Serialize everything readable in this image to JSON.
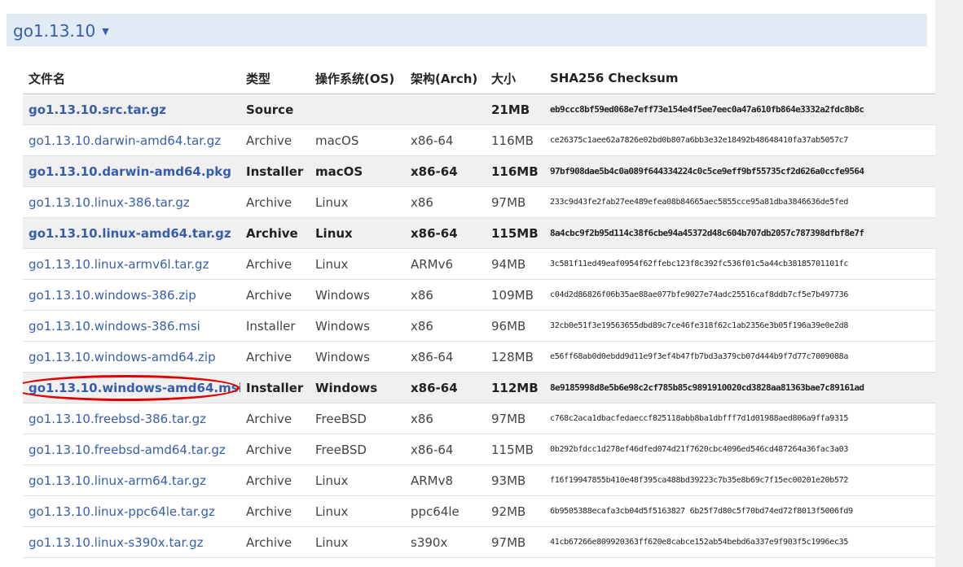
{
  "version": {
    "title": "go1.13.10",
    "arrow": "▼"
  },
  "table": {
    "headers": {
      "filename": "文件名",
      "kind": "类型",
      "os": "操作系统(OS)",
      "arch": "架构(Arch)",
      "size": "大小",
      "checksum": "SHA256 Checksum"
    },
    "rows": [
      {
        "filename": "go1.13.10.src.tar.gz",
        "kind": "Source",
        "os": "",
        "arch": "",
        "size": "21MB",
        "checksum": "eb9ccc8bf59ed068e7eff73e154e4f5ee7eec0a47a610fb864e3332a2fdc8b8c",
        "highlight": true
      },
      {
        "filename": "go1.13.10.darwin-amd64.tar.gz",
        "kind": "Archive",
        "os": "macOS",
        "arch": "x86-64",
        "size": "116MB",
        "checksum": "ce26375c1aee62a7826e02bd0b807a6bb3e32e18492b48648410fa37ab5057c7",
        "highlight": false
      },
      {
        "filename": "go1.13.10.darwin-amd64.pkg",
        "kind": "Installer",
        "os": "macOS",
        "arch": "x86-64",
        "size": "116MB",
        "checksum": "97bf908dae5b4c0a089f644334224c0c5ce9eff9bf55735cf2d626a0ccfe9564",
        "highlight": true
      },
      {
        "filename": "go1.13.10.linux-386.tar.gz",
        "kind": "Archive",
        "os": "Linux",
        "arch": "x86",
        "size": "97MB",
        "checksum": "233c9d43fe2fab27ee489efea08b84665aec5855cce95a81dba3846636de5fed",
        "highlight": false
      },
      {
        "filename": "go1.13.10.linux-amd64.tar.gz",
        "kind": "Archive",
        "os": "Linux",
        "arch": "x86-64",
        "size": "115MB",
        "checksum": "8a4cbc9f2b95d114c38f6cbe94a45372d48c604b707db2057c787398dfbf8e7f",
        "highlight": true
      },
      {
        "filename": "go1.13.10.linux-armv6l.tar.gz",
        "kind": "Archive",
        "os": "Linux",
        "arch": "ARMv6",
        "size": "94MB",
        "checksum": "3c581f11ed49eaf0954f62ffebc123f8c392fc536f01c5a44cb38185701101fc",
        "highlight": false
      },
      {
        "filename": "go1.13.10.windows-386.zip",
        "kind": "Archive",
        "os": "Windows",
        "arch": "x86",
        "size": "109MB",
        "checksum": "c04d2d86826f06b35ae88ae077bfe9027e74adc25516caf8ddb7cf5e7b497736",
        "highlight": false
      },
      {
        "filename": "go1.13.10.windows-386.msi",
        "kind": "Installer",
        "os": "Windows",
        "arch": "x86",
        "size": "96MB",
        "checksum": "32cb0e51f3e19563655dbd89c7ce46fe318f62c1ab2356e3b05f196a39e0e2d8",
        "highlight": false
      },
      {
        "filename": "go1.13.10.windows-amd64.zip",
        "kind": "Archive",
        "os": "Windows",
        "arch": "x86-64",
        "size": "128MB",
        "checksum": "e56ff68ab0d0ebdd9d11e9f3ef4b47fb7bd3a379cb07d444b9f7d77c7009088a",
        "highlight": false
      },
      {
        "filename": "go1.13.10.windows-amd64.msi",
        "kind": "Installer",
        "os": "Windows",
        "arch": "x86-64",
        "size": "112MB",
        "checksum": "8e9185998d8e5b6e98c2cf785b85c9891910020cd3828aa81363bae7c89161ad",
        "highlight": true,
        "circled": true
      },
      {
        "filename": "go1.13.10.freebsd-386.tar.gz",
        "kind": "Archive",
        "os": "FreeBSD",
        "arch": "x86",
        "size": "97MB",
        "checksum": "c768c2aca1dbacfedaeccf825118abb8ba1dbfff7d1d01988aed806a9ffa9315",
        "highlight": false
      },
      {
        "filename": "go1.13.10.freebsd-amd64.tar.gz",
        "kind": "Archive",
        "os": "FreeBSD",
        "arch": "x86-64",
        "size": "115MB",
        "checksum": "0b292bfdcc1d278ef46dfed074d21f7620cbc4096ed546cd487264a36fac3a03",
        "highlight": false
      },
      {
        "filename": "go1.13.10.linux-arm64.tar.gz",
        "kind": "Archive",
        "os": "Linux",
        "arch": "ARMv8",
        "size": "93MB",
        "checksum": "f16f19947855b410e48f395ca488bd39223c7b35e8b69c7f15ec00201e20b572",
        "highlight": false
      },
      {
        "filename": "go1.13.10.linux-ppc64le.tar.gz",
        "kind": "Archive",
        "os": "Linux",
        "arch": "ppc64le",
        "size": "92MB",
        "checksum": "6b9505388ecafa3cb04d5f5163827 6b25f7d80c5f70bd74ed72f8013f5006fd9",
        "highlight": false
      },
      {
        "filename": "go1.13.10.linux-s390x.tar.gz",
        "kind": "Archive",
        "os": "Linux",
        "arch": "s390x",
        "size": "97MB",
        "checksum": "41cb67266e809920363ff620e8cabce152ab54bebd6a337e9f903f5c1996ec35",
        "highlight": false
      }
    ]
  },
  "colors": {
    "link": "#375eab",
    "header_bg": "#e0ebf5",
    "highlight_bg": "#f0f0f0",
    "annotation": "#e00000"
  }
}
